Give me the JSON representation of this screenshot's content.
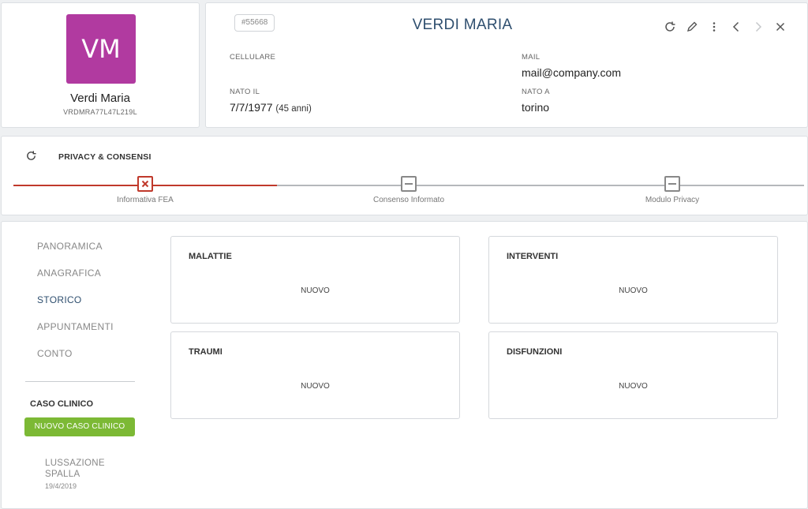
{
  "profile": {
    "initials": "VM",
    "avatar_color": "#b13aa0",
    "name": "Verdi Maria",
    "code": "VRDMRA77L47L219L"
  },
  "header": {
    "record_id": "#55668",
    "title": "VERDI MARIA",
    "toolbar_icons": [
      "refresh-icon",
      "edit-pencil-icon",
      "more-vertical-icon",
      "chevron-left-icon",
      "chevron-right-icon",
      "close-icon"
    ],
    "fields": {
      "phone_label": "CELLULARE",
      "phone_value": "",
      "email_label": "MAIL",
      "email_value": "mail@company.com",
      "birthdate_label": "NATO IL",
      "birthdate_value": "7/7/1977",
      "age_value": "(45 anni)",
      "birthplace_label": "NATO A",
      "birthplace_value": "torino"
    }
  },
  "privacy": {
    "title": "PRIVACY & CONSENSI",
    "accent_color": "#c0392b",
    "steps": [
      {
        "label": "Informativa FEA",
        "status": "error"
      },
      {
        "label": "Consenso Informato",
        "status": "pending"
      },
      {
        "label": "Modulo Privacy",
        "status": "pending"
      }
    ]
  },
  "nav": {
    "items": [
      {
        "label": "PANORAMICA",
        "active": false
      },
      {
        "label": "ANAGRAFICA",
        "active": false
      },
      {
        "label": "STORICO",
        "active": true
      },
      {
        "label": "APPUNTAMENTI",
        "active": false
      },
      {
        "label": "CONTO",
        "active": false
      }
    ]
  },
  "clinical_case": {
    "title": "CASO CLINICO",
    "new_button": "NUOVO CASO CLINICO",
    "button_color": "#7cb935",
    "cases": [
      {
        "name": "LUSSAZIONE SPALLA",
        "date": "19/4/2019"
      }
    ]
  },
  "cards": [
    {
      "title": "MALATTIE",
      "action": "NUOVO"
    },
    {
      "title": "INTERVENTI",
      "action": "NUOVO"
    },
    {
      "title": "TRAUMI",
      "action": "NUOVO"
    },
    {
      "title": "DISFUNZIONI",
      "action": "NUOVO"
    }
  ]
}
